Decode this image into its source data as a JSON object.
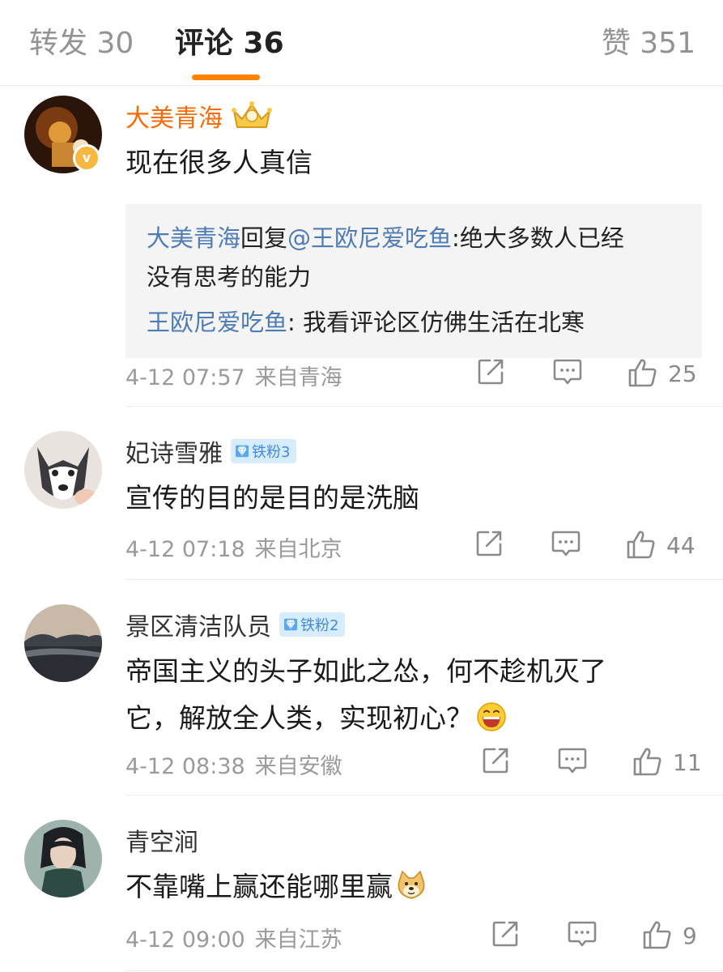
{
  "tabs": {
    "repost": "转发 30",
    "comments": "评论 36",
    "likes": "赞 351",
    "accent": "#ff8200"
  },
  "comments": [
    {
      "name": "大美青海",
      "verified": true,
      "crown_icon": "crown-icon",
      "text_lines": [
        "现在很多人真信"
      ],
      "replies": [
        {
          "name": "大美青海",
          "mid": "回复",
          "mention": "@王欧尼爱吃鱼",
          "text_a": ":绝大多数人已经",
          "text_b": "没有思考的能力"
        },
        {
          "name": "王欧尼爱吃鱼",
          "text": ": 我看评论区仿佛生活在北寒"
        }
      ],
      "time": "4-12 07:57",
      "source": "来自青海",
      "likes": "25"
    },
    {
      "name": "妃诗雪雅",
      "badge": "铁粉3",
      "text_lines": [
        "宣传的目的是目的是洗脑"
      ],
      "time": "4-12 07:18",
      "source": "来自北京",
      "likes": "44"
    },
    {
      "name": "景区清洁队员",
      "badge": "铁粉2",
      "text_lines": [
        "帝国主义的头子如此之怂，何不趁机灭了",
        "它，解放全人类，实现初心？"
      ],
      "emoji": "grin-emoji",
      "time": "4-12 08:38",
      "source": "来自安徽",
      "likes": "11"
    },
    {
      "name": "青空涧",
      "text_lines": [
        "不靠嘴上赢还能哪里赢"
      ],
      "emoji": "doge-emoji",
      "time": "4-12 09:00",
      "source": "来自江苏",
      "likes": "9"
    }
  ],
  "icons": [
    "share-icon",
    "comment-icon",
    "thumbs-up-icon"
  ],
  "colors": {
    "vip_name": "#f86a05",
    "link": "#4f7cb5",
    "badge_bg": "#d7ecfd",
    "badge_text": "#3f8be3"
  }
}
